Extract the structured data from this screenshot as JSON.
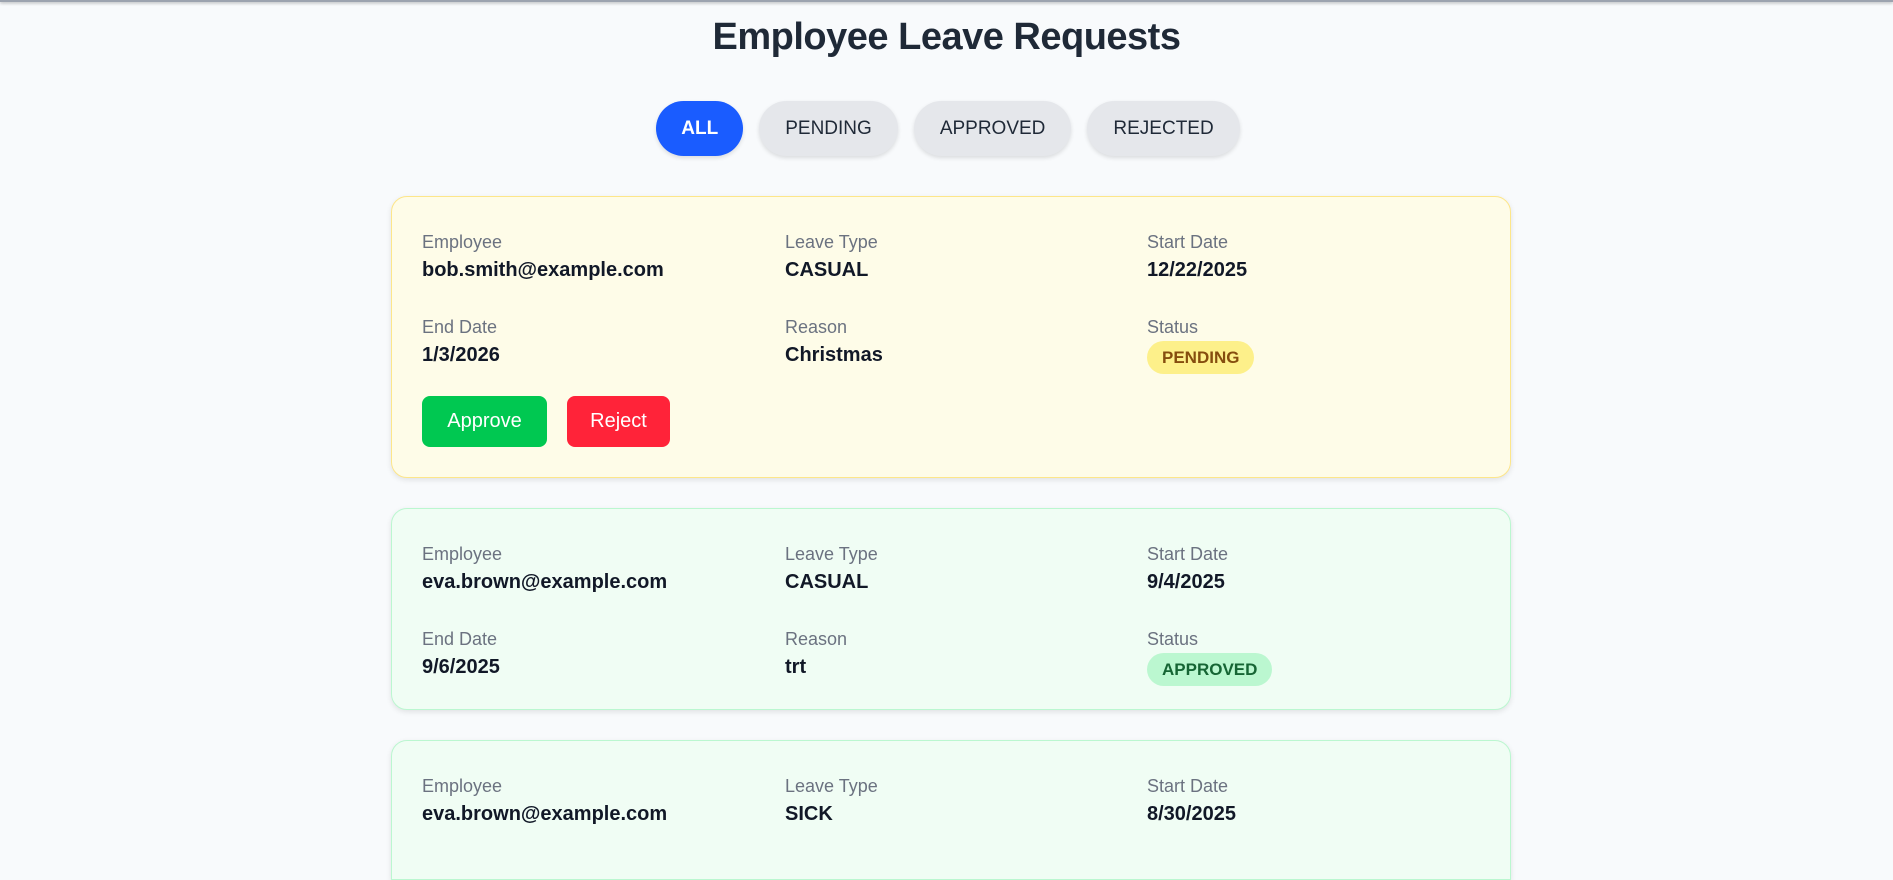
{
  "page": {
    "title": "Employee Leave Requests"
  },
  "filters": [
    {
      "label": "ALL",
      "active": true
    },
    {
      "label": "PENDING",
      "active": false
    },
    {
      "label": "APPROVED",
      "active": false
    },
    {
      "label": "REJECTED",
      "active": false
    }
  ],
  "labels": {
    "employee": "Employee",
    "leave_type": "Leave Type",
    "start_date": "Start Date",
    "end_date": "End Date",
    "reason": "Reason",
    "status": "Status"
  },
  "actions": {
    "approve": "Approve",
    "reject": "Reject"
  },
  "requests": [
    {
      "employee": "bob.smith@example.com",
      "leave_type": "CASUAL",
      "start_date": "12/22/2025",
      "end_date": "1/3/2026",
      "reason": "Christmas",
      "status": "PENDING"
    },
    {
      "employee": "eva.brown@example.com",
      "leave_type": "CASUAL",
      "start_date": "9/4/2025",
      "end_date": "9/6/2025",
      "reason": "trt",
      "status": "APPROVED"
    },
    {
      "employee": "eva.brown@example.com",
      "leave_type": "SICK",
      "start_date": "8/30/2025"
    }
  ],
  "colors": {
    "primary": "#1a5cff",
    "approve": "#00c851",
    "reject": "#ff2339",
    "pending_bg": "#fefce8",
    "approved_bg": "#f0fdf4"
  }
}
